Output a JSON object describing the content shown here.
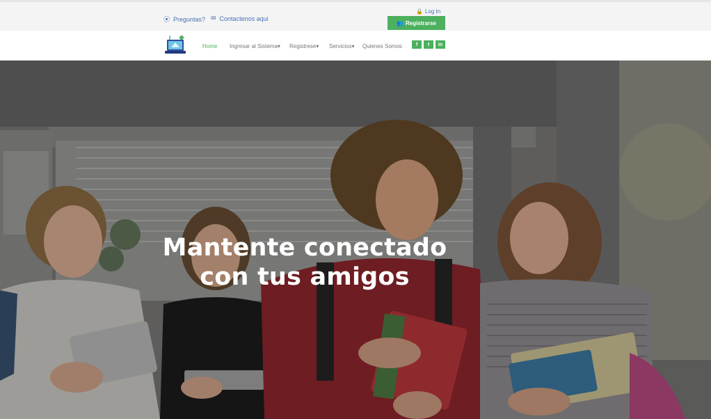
{
  "topbar": {
    "faq": "Preguntas?",
    "contact": "Contactenos aqui",
    "login": "Log In",
    "register": "Registrarse"
  },
  "nav": {
    "home": "Home",
    "login_system": "Ingresar al Sistema",
    "register": "Registrese",
    "services": "Servicios",
    "about": "Quienes Somos"
  },
  "social": {
    "facebook": "f",
    "twitter": "t",
    "linkedin": "in"
  },
  "hero": {
    "line1": "Mantente conectado",
    "line2": "con tus amigos"
  },
  "colors": {
    "accent": "#4cb05f",
    "link": "#4a6fb3"
  }
}
